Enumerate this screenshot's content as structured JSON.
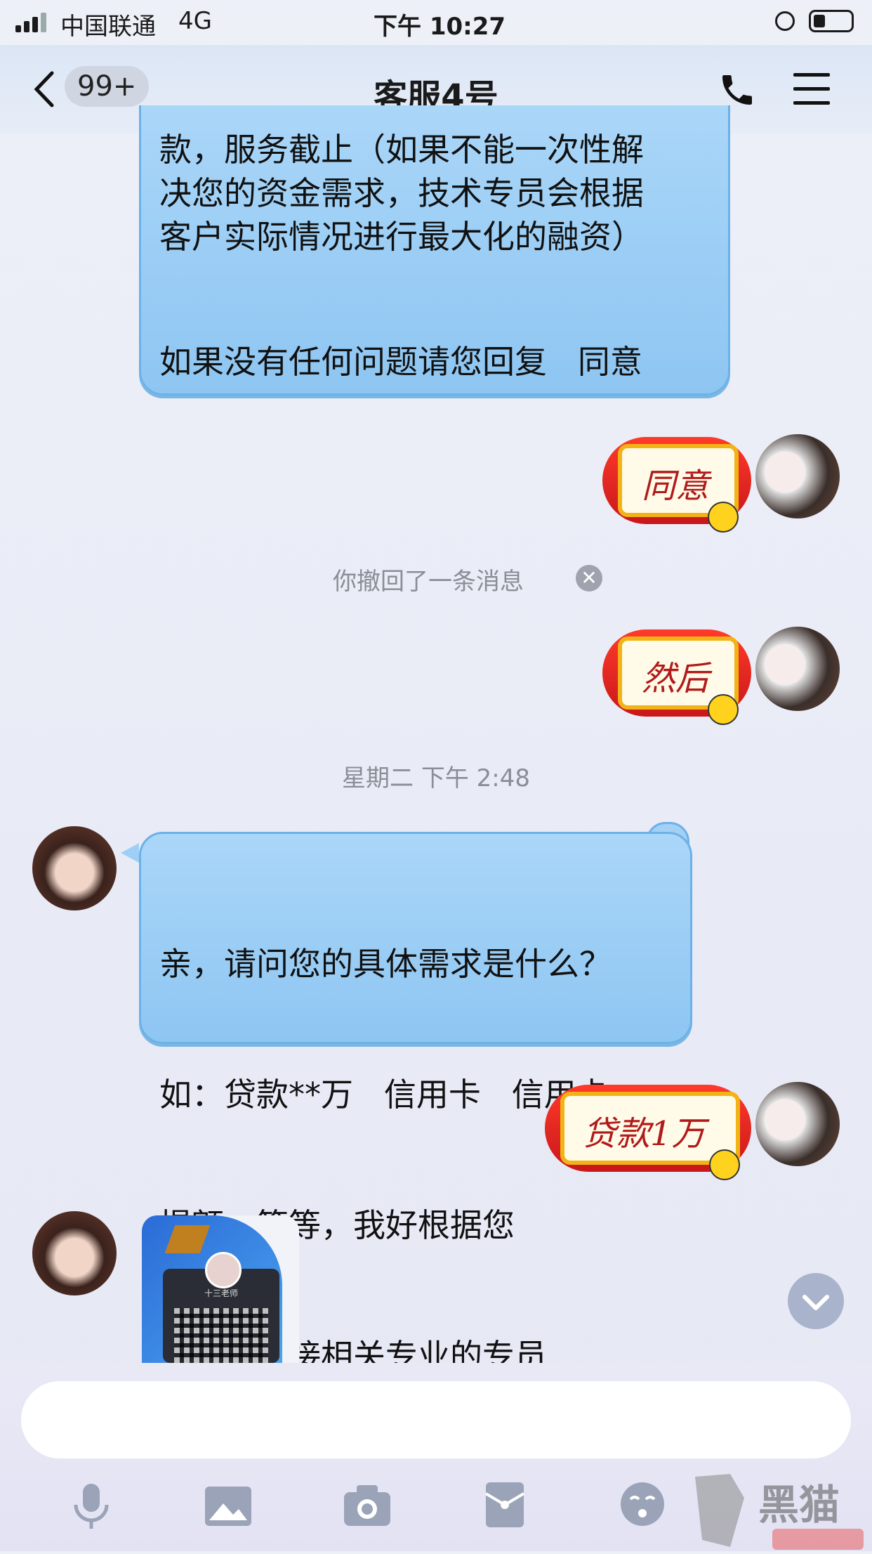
{
  "status_bar": {
    "carrier": "中国联通",
    "network": "4G",
    "time": "下午 10:27"
  },
  "nav": {
    "back_badge": "99+",
    "title": "客服4号",
    "icons": [
      "back-chevron-icon",
      "phone-icon",
      "menu-icon"
    ]
  },
  "messages": [
    {
      "side": "left",
      "type": "text",
      "lines": [
        "款，服务截止（如果不能一次性解",
        "决您的资金需求，技术专员会根据",
        "客户实际情况进行最大化的融资）",
        "",
        "如果没有任何问题请您回复   同意"
      ]
    },
    {
      "side": "right",
      "type": "sticker",
      "text": "同意"
    },
    {
      "type": "system",
      "text": "你撤回了一条消息"
    },
    {
      "side": "right",
      "type": "sticker",
      "text": "然后"
    },
    {
      "type": "timestamp",
      "text": "星期二 下午 2:48"
    },
    {
      "side": "left",
      "type": "text",
      "lines": [
        "亲，请问您的具体需求是什么？",
        "如：贷款**万   信用卡   信用卡",
        "提额，等等，我好根据您",
        "的需求对接相关专业的专员"
      ]
    },
    {
      "side": "right",
      "type": "sticker",
      "text": "贷款1万"
    },
    {
      "side": "left",
      "type": "image-card",
      "card_name": "十三老师"
    }
  ],
  "input": {
    "placeholder": ""
  },
  "toolbar": [
    "microphone-icon",
    "image-icon",
    "camera-icon",
    "red-packet-icon",
    "emoji-icon"
  ],
  "colors": {
    "bubble": "#9dcef5",
    "accent_red": "#d82020",
    "nav_bg": "#dde7f5"
  }
}
